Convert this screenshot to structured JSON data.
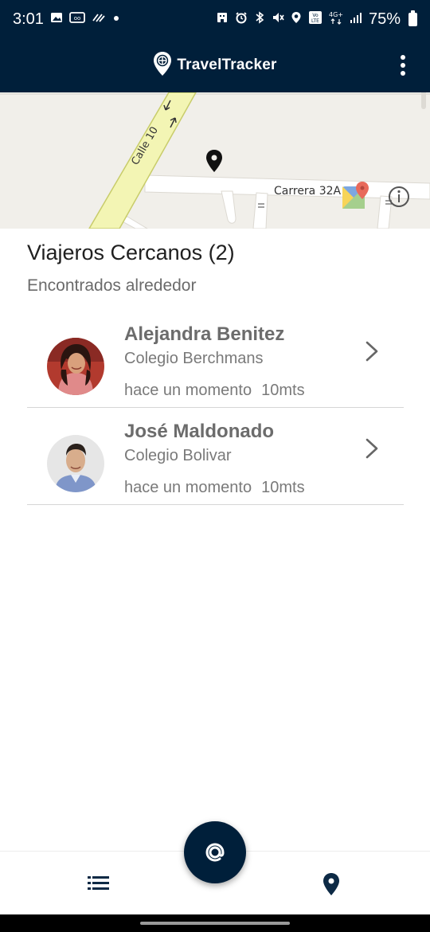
{
  "status_bar": {
    "time": "3:01",
    "battery": "75%",
    "left_icons": [
      "gallery-icon",
      "cc-icon",
      "wave-icon",
      "dot-icon"
    ],
    "right_icons": [
      "hotel-icon",
      "alarm-icon",
      "bluetooth-icon",
      "mute-icon",
      "location-icon",
      "volte-icon",
      "4g-icon",
      "signal-icon",
      "battery-icon"
    ],
    "volte_text": "Vo LTE",
    "network_text": "4G+"
  },
  "app_bar": {
    "title": "TravelTracker",
    "menu_icon": "more-vert-icon"
  },
  "map": {
    "street_1": "Calle 10",
    "street_2": "Carrera 32A",
    "marker_icon": "map-pin-icon",
    "info_icon": "info-icon"
  },
  "section": {
    "title": "Viajeros Cercanos (2)",
    "subtitle": "Encontrados alrededor"
  },
  "travelers": [
    {
      "name": "Alejandra Benitez",
      "school": "Colegio Berchmans",
      "time": "hace un momento",
      "distance": "10mts"
    },
    {
      "name": "José Maldonado",
      "school": "Colegio Bolivar",
      "time": "hace un momento",
      "distance": "10mts"
    }
  ],
  "bottom_nav": {
    "left_icon": "list-icon",
    "center_icon": "at-sign-icon",
    "right_icon": "location-pin-icon"
  },
  "colors": {
    "primary": "#001f3a",
    "road_yellow": "#f3f5b4",
    "road_edge": "#c8cc6a",
    "map_bg": "#f1efea"
  }
}
